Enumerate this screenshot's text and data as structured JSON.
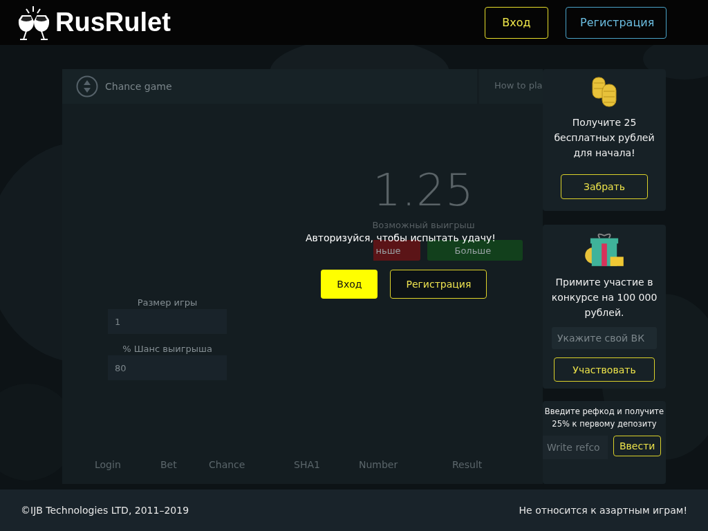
{
  "header": {
    "logo": "RusRulet",
    "buttons": [
      {
        "label": "Вход",
        "kind": "login"
      },
      {
        "label": "Регистрация",
        "kind": "register"
      }
    ]
  },
  "game": {
    "title": "Chance game",
    "tab": "How to pla",
    "multiplier": "1.25",
    "multiplier_label": "Возможный выигрыш",
    "bet_buttons": [
      {
        "label": "ньше",
        "kind": "less"
      },
      {
        "label": "Больше",
        "kind": "more"
      }
    ],
    "fields": [
      {
        "label": "Размер игры",
        "value": "1"
      },
      {
        "label": "% Шанс выигрыша",
        "value": "80"
      }
    ],
    "history_columns": [
      "Login",
      "Bet",
      "Chance",
      "SHA1",
      "Number",
      "Result"
    ],
    "overlay": {
      "message": "Авторизуйся, чтобы испытать удачу!",
      "buttons": [
        {
          "label": "Вход",
          "kind": "login"
        },
        {
          "label": "Регистрация",
          "kind": "register"
        }
      ]
    }
  },
  "sidebar": [
    {
      "kind": "bonus",
      "text": "Получите 25 бесплатных рублей для начала!",
      "button": "Забрать"
    },
    {
      "kind": "contest",
      "text": "Примите участие в конкурсе на 100 000 рублей.",
      "placeholder": "Укажите свой ВК",
      "button": "Участвовать"
    },
    {
      "kind": "refcode",
      "text": "Введите рефкод и получите 25% к первому депозиту",
      "placeholder": "Write refco",
      "button": "Ввести"
    }
  ],
  "footer": {
    "copyright": "©IJB Technologies LTD, 2011–2019",
    "disclaimer": "Не относится к азартным играм!"
  }
}
